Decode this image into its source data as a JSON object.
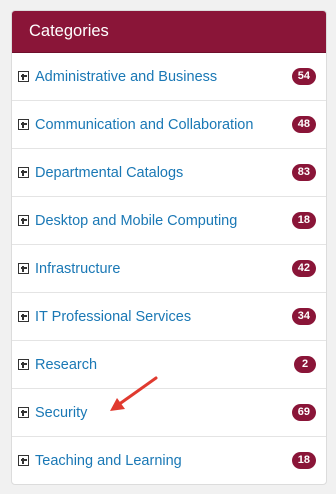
{
  "panel": {
    "title": "Categories",
    "header_color": "#8a1538",
    "link_color": "#1a78b5",
    "items": [
      {
        "label": "Administrative and Business",
        "count": "54"
      },
      {
        "label": "Communication and Collaboration",
        "count": "48"
      },
      {
        "label": "Departmental Catalogs",
        "count": "83"
      },
      {
        "label": "Desktop and Mobile Computing",
        "count": "18"
      },
      {
        "label": "Infrastructure",
        "count": "42"
      },
      {
        "label": "IT Professional Services",
        "count": "34"
      },
      {
        "label": "Research",
        "count": "2"
      },
      {
        "label": "Security",
        "count": "69"
      },
      {
        "label": "Teaching and Learning",
        "count": "18"
      }
    ]
  },
  "annotation": {
    "icon": "red-arrow-icon",
    "color": "#e03a2f"
  }
}
